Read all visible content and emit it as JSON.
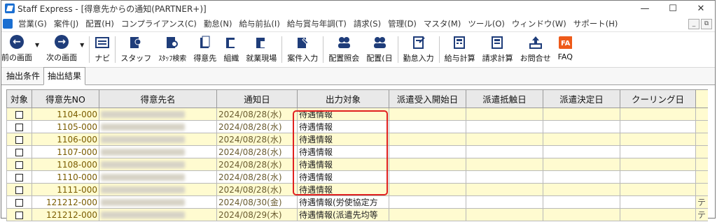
{
  "window": {
    "title": "Staff Express - [得意先からの通知(PARTNER+)]",
    "buttons": [
      "—",
      "☐",
      "✕"
    ]
  },
  "menu": {
    "items": [
      "営業(G)",
      "案件(J)",
      "配置(H)",
      "コンプライアンス(C)",
      "勤怠(N)",
      "給与前払(I)",
      "給与賞与年調(T)",
      "請求(S)",
      "管理(D)",
      "マスタ(M)",
      "ツール(O)",
      "ウィンドウ(W)",
      "サポート(H)"
    ],
    "mdi_buttons": [
      "_",
      "⧉"
    ]
  },
  "toolbar": {
    "prev": "前の画面",
    "next": "次の画面",
    "buttons": [
      {
        "label": "ナビ",
        "icon": "navi-icon"
      },
      {
        "label": "スタッフ",
        "icon": "staff-icon"
      },
      {
        "label": "ｽﾀｯﾌ検索",
        "icon": "staff-search-icon"
      },
      {
        "label": "得意先",
        "icon": "client-icon"
      },
      {
        "label": "組織",
        "icon": "organization-icon"
      },
      {
        "label": "就業現場",
        "icon": "workplace-icon"
      },
      {
        "label": "案件入力",
        "icon": "case-entry-icon"
      },
      {
        "label": "配置照会",
        "icon": "placement-inquiry-icon"
      },
      {
        "label": "配置(日",
        "icon": "placement-day-icon"
      },
      {
        "label": "勤怠入力",
        "icon": "attendance-entry-icon"
      },
      {
        "label": "給与計算",
        "icon": "payroll-icon"
      },
      {
        "label": "請求計算",
        "icon": "billing-icon"
      },
      {
        "label": "お問合せ",
        "icon": "inquiry-icon"
      },
      {
        "label": "FAQ",
        "icon": "faq-icon"
      }
    ]
  },
  "tabs": [
    {
      "label": "抽出条件",
      "active": false
    },
    {
      "label": "抽出結果",
      "active": true
    }
  ],
  "table": {
    "headers": [
      "対象",
      "得意先NO",
      "得意先名",
      "通知日",
      "出力対象",
      "派遣受入開始日",
      "派遣抵触日",
      "派遣決定日",
      "クーリング日"
    ],
    "rows": [
      {
        "code": "1104-000",
        "date": "2024/08/28(水)",
        "target": "待遇情報",
        "style": "yellow"
      },
      {
        "code": "1105-000",
        "date": "2024/08/28(水)",
        "target": "待遇情報",
        "style": "white"
      },
      {
        "code": "1106-000",
        "date": "2024/08/28(水)",
        "target": "待遇情報",
        "style": "yellow"
      },
      {
        "code": "1107-000",
        "date": "2024/08/28(水)",
        "target": "待遇情報",
        "style": "white"
      },
      {
        "code": "1108-000",
        "date": "2024/08/28(水)",
        "target": "待遇情報",
        "style": "yellow"
      },
      {
        "code": "1110-000",
        "date": "2024/08/28(水)",
        "target": "待遇情報",
        "style": "white"
      },
      {
        "code": "1111-000",
        "date": "2024/08/28(水)",
        "target": "待遇情報",
        "style": "yellow"
      },
      {
        "code": "121212-000",
        "date": "2024/08/30(金)",
        "target": "待遇情報(労使協定方",
        "style": "white",
        "edge": "テ"
      },
      {
        "code": "121212-000",
        "date": "2024/08/29(木)",
        "target": "待遇情報(派遣先均等",
        "style": "yellow",
        "edge": "テ"
      }
    ]
  },
  "colors": {
    "highlight": "#e02020",
    "row_yellow": "#fffbd0"
  }
}
